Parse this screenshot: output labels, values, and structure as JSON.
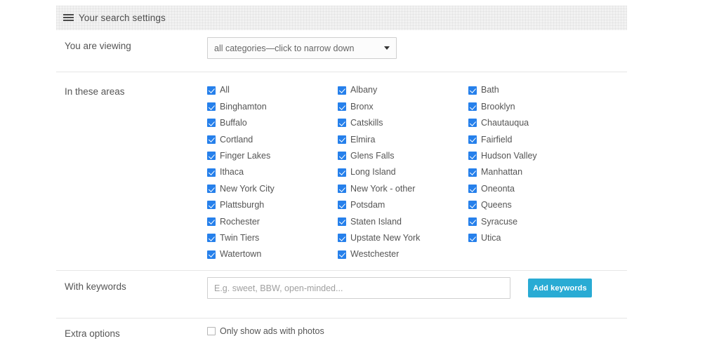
{
  "header": {
    "title": "Your search settings",
    "menu_icon": "hamburger-icon"
  },
  "viewing": {
    "label": "You are viewing",
    "selected_category": "all categories—click to narrow down",
    "caret_icon": "caret-down-icon"
  },
  "areas": {
    "label": "In these areas",
    "columns": [
      {
        "items": [
          {
            "label": "All",
            "checked": true
          },
          {
            "label": "Binghamton",
            "checked": true
          },
          {
            "label": "Buffalo",
            "checked": true
          },
          {
            "label": "Cortland",
            "checked": true
          },
          {
            "label": "Finger Lakes",
            "checked": true
          },
          {
            "label": "Ithaca",
            "checked": true
          },
          {
            "label": "New York City",
            "checked": true
          },
          {
            "label": "Plattsburgh",
            "checked": true
          },
          {
            "label": "Rochester",
            "checked": true
          },
          {
            "label": "Twin Tiers",
            "checked": true
          },
          {
            "label": "Watertown",
            "checked": true
          }
        ]
      },
      {
        "items": [
          {
            "label": "Albany",
            "checked": true
          },
          {
            "label": "Bronx",
            "checked": true
          },
          {
            "label": "Catskills",
            "checked": true
          },
          {
            "label": "Elmira",
            "checked": true
          },
          {
            "label": "Glens Falls",
            "checked": true
          },
          {
            "label": "Long Island",
            "checked": true
          },
          {
            "label": "New York - other",
            "checked": true
          },
          {
            "label": "Potsdam",
            "checked": true
          },
          {
            "label": "Staten Island",
            "checked": true
          },
          {
            "label": "Upstate New York",
            "checked": true
          },
          {
            "label": "Westchester",
            "checked": true
          }
        ]
      },
      {
        "items": [
          {
            "label": "Bath",
            "checked": true
          },
          {
            "label": "Brooklyn",
            "checked": true
          },
          {
            "label": "Chautauqua",
            "checked": true
          },
          {
            "label": "Fairfield",
            "checked": true
          },
          {
            "label": "Hudson Valley",
            "checked": true
          },
          {
            "label": "Manhattan",
            "checked": true
          },
          {
            "label": "Oneonta",
            "checked": true
          },
          {
            "label": "Queens",
            "checked": true
          },
          {
            "label": "Syracuse",
            "checked": true
          },
          {
            "label": "Utica",
            "checked": true
          }
        ]
      }
    ]
  },
  "keywords": {
    "label": "With keywords",
    "value": "",
    "placeholder": "E.g. sweet, BBW, open-minded...",
    "button_label": "Add keywords"
  },
  "extra_options": {
    "label": "Extra options",
    "photos_only": {
      "label": "Only show ads with photos",
      "checked": false
    }
  },
  "colors": {
    "checkbox_blue": "#2680eb",
    "button_teal": "#29abd4",
    "header_gray": "#f2f2f2",
    "divider": "#e6e6e6",
    "text": "#555555"
  }
}
